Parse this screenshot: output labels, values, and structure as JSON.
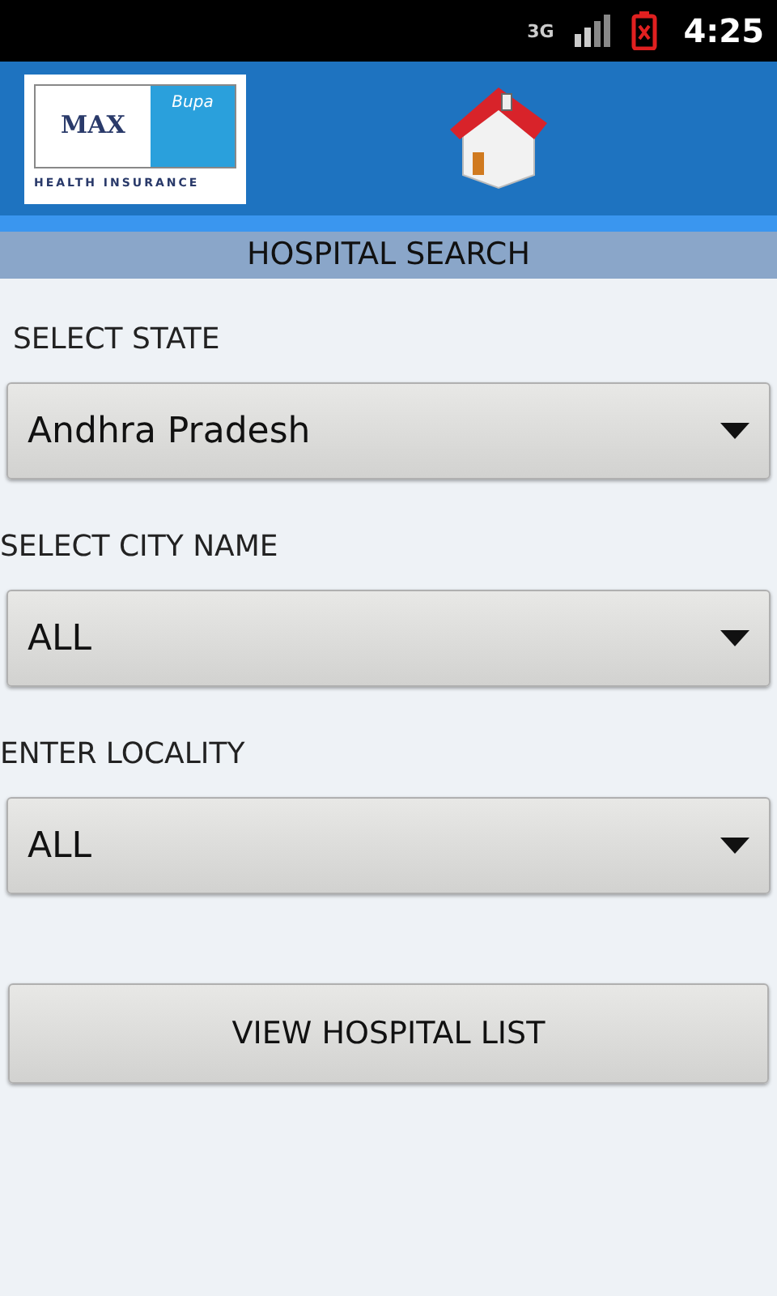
{
  "status_bar": {
    "network": "3G",
    "time": "4:25"
  },
  "header": {
    "logo": {
      "brand": "MAX",
      "partner": "Bupa",
      "tagline": "HEALTH INSURANCE"
    }
  },
  "title": "HOSPITAL SEARCH",
  "fields": [
    {
      "label": "SELECT STATE",
      "value": "Andhra Pradesh",
      "indented": true
    },
    {
      "label": "SELECT CITY NAME",
      "value": "ALL",
      "indented": false
    },
    {
      "label": "ENTER LOCALITY",
      "value": "ALL",
      "indented": false
    }
  ],
  "button": "VIEW HOSPITAL LIST"
}
